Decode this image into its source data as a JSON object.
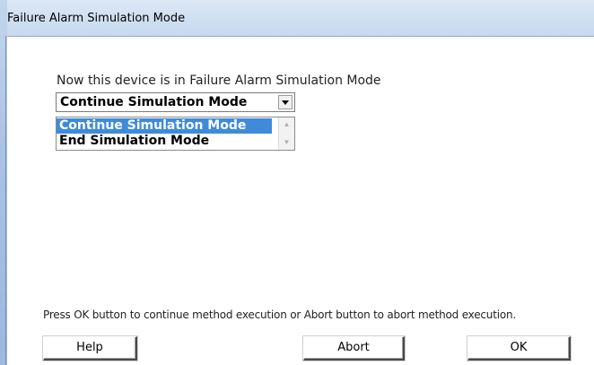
{
  "window": {
    "title": "Failure Alarm Simulation Mode"
  },
  "main": {
    "info_text": "Now this device is in Failure Alarm Simulation Mode",
    "select": {
      "value": "Continue Simulation Mode",
      "options": [
        {
          "label": "Continue Simulation Mode",
          "selected": true
        },
        {
          "label": "End Simulation Mode",
          "selected": false
        }
      ]
    },
    "instruction": "Press OK button to continue method execution or Abort button to abort method execution."
  },
  "buttons": {
    "help": "Help",
    "abort": "Abort",
    "ok": "OK"
  },
  "colors": {
    "selection": "#3f8bd9",
    "title_bar": "#cfdff1"
  },
  "icons": {
    "dropdown": "chevron-down-icon",
    "scroll_up": "scroll-up-arrow-icon",
    "scroll_down": "scroll-down-arrow-icon"
  }
}
